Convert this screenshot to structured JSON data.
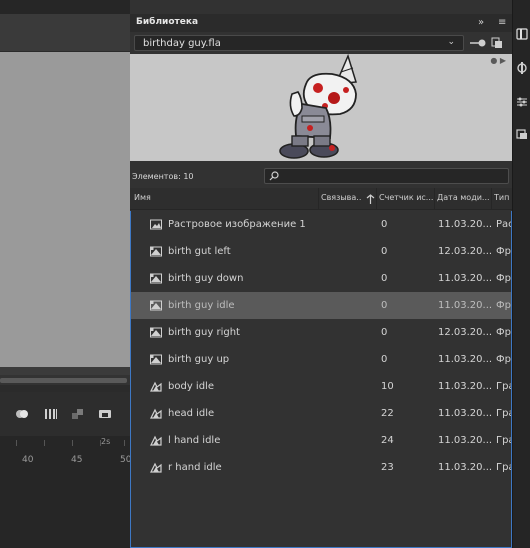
{
  "library": {
    "panel_title": "Библиотека",
    "expand_icon": "double-chevron-right-icon",
    "menu_icon": "hamburger-menu-icon",
    "document": "birthday guy.fla",
    "element_count": "Элементов: 10",
    "search_placeholder": "",
    "columns": {
      "name": "Имя",
      "linkage": "Связыва...",
      "usage": "Счетчик ис...",
      "date": "Дата моди...",
      "type": "Тип"
    },
    "items": [
      {
        "name": "Растровое изображение 1",
        "count": "0",
        "date": "11.03.20...",
        "type": "Рас",
        "icon": "bitmap-icon"
      },
      {
        "name": "birth gut left",
        "count": "0",
        "date": "12.03.20...",
        "type": "Фр",
        "icon": "movieclip-icon"
      },
      {
        "name": "birth guy down",
        "count": "0",
        "date": "11.03.20...",
        "type": "Фр",
        "icon": "movieclip-icon"
      },
      {
        "name": "birth guy idle",
        "count": "0",
        "date": "11.03.20...",
        "type": "Фр",
        "icon": "movieclip-icon",
        "selected": true
      },
      {
        "name": "birth guy right",
        "count": "0",
        "date": "12.03.20...",
        "type": "Фр",
        "icon": "movieclip-icon"
      },
      {
        "name": "birth guy up",
        "count": "0",
        "date": "11.03.20...",
        "type": "Фр",
        "icon": "movieclip-icon"
      },
      {
        "name": "body idle",
        "count": "10",
        "date": "11.03.20...",
        "type": "Гра",
        "icon": "graphic-symbol-icon"
      },
      {
        "name": "head idle",
        "count": "22",
        "date": "11.03.20...",
        "type": "Гра",
        "icon": "graphic-symbol-icon"
      },
      {
        "name": "l hand idle",
        "count": "24",
        "date": "11.03.20...",
        "type": "Гра",
        "icon": "graphic-symbol-icon"
      },
      {
        "name": "r hand idle",
        "count": "23",
        "date": "11.03.20...",
        "type": "Гра",
        "icon": "graphic-symbol-icon"
      }
    ]
  },
  "timeline": {
    "ruler_numbers": [
      "40",
      "45",
      "50"
    ],
    "ruler_seconds": "2s"
  },
  "colors": {
    "panel_bg": "#323232",
    "selection": "#5a5a5a",
    "focus_border": "#3e78c4",
    "stage_bg": "#9a9a9a",
    "preview_bg": "#c7c7c7"
  }
}
